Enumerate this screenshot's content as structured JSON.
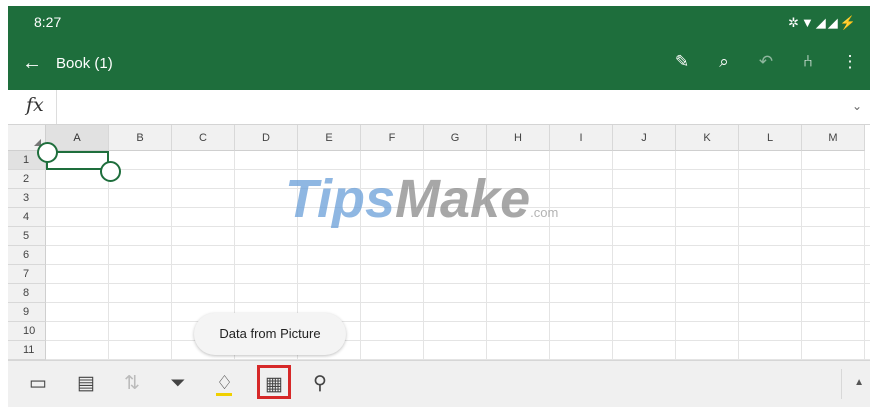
{
  "status_bar": {
    "time": "8:27",
    "system_icons": "✲▼◢◢⚡"
  },
  "app_bar": {
    "back_icon": "←",
    "title": "Book (1)",
    "icons": [
      {
        "name": "draw-icon",
        "glyph": "✎"
      },
      {
        "name": "search-icon",
        "glyph": "⌕"
      },
      {
        "name": "undo-icon",
        "glyph": "↶"
      },
      {
        "name": "share-icon",
        "glyph": "⑃"
      },
      {
        "name": "more-icon",
        "glyph": "⋮"
      }
    ]
  },
  "formula_bar": {
    "fx_label": "fx",
    "value": "",
    "expand_icon": "⌄"
  },
  "sheet": {
    "columns": [
      "A",
      "B",
      "C",
      "D",
      "E",
      "F",
      "G",
      "H",
      "I",
      "J",
      "K",
      "L",
      "M"
    ],
    "rows": [
      "1",
      "2",
      "3",
      "4",
      "5",
      "6",
      "7",
      "8",
      "9",
      "10",
      "11"
    ],
    "selected_cell": "A1"
  },
  "watermark": {
    "part1": "Tips",
    "part2": "Make",
    "suffix": ".com"
  },
  "tooltip": {
    "label": "Data from Picture"
  },
  "toolbar": {
    "buttons": [
      {
        "name": "insert-icon",
        "glyph": "▭"
      },
      {
        "name": "card-view-icon",
        "glyph": "▤"
      },
      {
        "name": "sort-icon",
        "glyph": "⇅",
        "disabled": true
      },
      {
        "name": "filter-icon",
        "glyph": "⏷"
      },
      {
        "name": "fill-color-icon",
        "glyph": "♢"
      },
      {
        "name": "data-from-picture-icon",
        "glyph": "▦",
        "highlighted": true
      },
      {
        "name": "ideas-icon",
        "glyph": "⚲"
      }
    ],
    "expand_icon": "▲"
  },
  "colors": {
    "brand_green": "#1e6e3c",
    "highlight_red": "#d62828"
  }
}
